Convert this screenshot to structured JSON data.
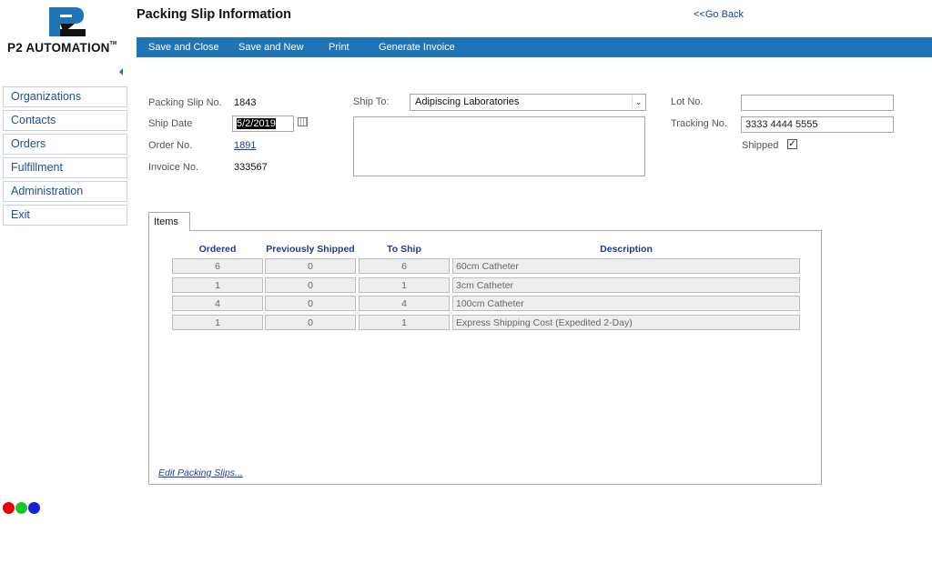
{
  "logo": {
    "text": "P2 AUTOMATION",
    "trademark": "TM"
  },
  "header": {
    "title": "Packing Slip Information",
    "go_back": "<<Go Back"
  },
  "toolbar": {
    "save_close": "Save and Close",
    "save_new": "Save and New",
    "print": "Print",
    "generate_invoice": "Generate Invoice"
  },
  "sidebar": {
    "items": [
      {
        "label": "Organizations"
      },
      {
        "label": "Contacts"
      },
      {
        "label": "Orders"
      },
      {
        "label": "Fulfillment"
      },
      {
        "label": "Administration"
      },
      {
        "label": "Exit"
      }
    ]
  },
  "form": {
    "packing_slip_label": "Packing Slip No.",
    "packing_slip_value": "1843",
    "ship_date_label": "Ship Date",
    "ship_date_value": "5/2/2019",
    "order_no_label": "Order No.",
    "order_no_value": "1891",
    "invoice_no_label": "Invoice No.",
    "invoice_no_value": "333567",
    "ship_to_label": "Ship To:",
    "ship_to_value": "Adipiscing Laboratories",
    "ship_to_address": "",
    "lot_no_label": "Lot No.",
    "lot_no_value": "",
    "tracking_label": "Tracking No.",
    "tracking_value": "3333 4444 5555",
    "shipped_label": "Shipped",
    "shipped_checked": true
  },
  "items_tab": {
    "tab_label": "Items",
    "columns": [
      "Ordered",
      "Previously Shipped",
      "To Ship",
      "Description"
    ],
    "rows": [
      {
        "ordered": "6",
        "previously_shipped": "0",
        "to_ship": "6",
        "description": "60cm Catheter"
      },
      {
        "ordered": "1",
        "previously_shipped": "0",
        "to_ship": "1",
        "description": "3cm Catheter"
      },
      {
        "ordered": "4",
        "previously_shipped": "0",
        "to_ship": "4",
        "description": "100cm Catheter"
      },
      {
        "ordered": "1",
        "previously_shipped": "0",
        "to_ship": "1",
        "description": "Express Shipping Cost (Expedited 2-Day)"
      }
    ],
    "edit_link": "Edit Packing Slips..."
  },
  "status_dots": [
    {
      "color": "#e8000b",
      "name": "red-dot"
    },
    {
      "color": "#16c72e",
      "name": "green-dot"
    },
    {
      "color": "#1422d6",
      "name": "blue-dot"
    }
  ],
  "colors": {
    "toolbar": "#1f73b7",
    "nav_text": "#1f4e9a",
    "header_blue": "#1f3d8f"
  }
}
